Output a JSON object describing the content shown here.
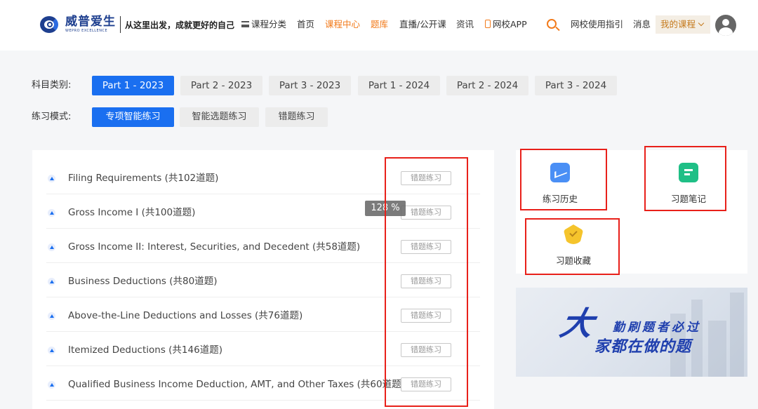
{
  "header": {
    "logo_cn": "威普爱生",
    "logo_en": "WEPRO EXCELLENCE",
    "slogan": "从这里出发，成就更好的自己",
    "nav": [
      {
        "label": "课程分类",
        "active": false
      },
      {
        "label": "首页",
        "active": false
      },
      {
        "label": "课程中心",
        "active": true
      },
      {
        "label": "题库",
        "active": true
      },
      {
        "label": "直播/公开课",
        "active": false
      },
      {
        "label": "资讯",
        "active": false
      },
      {
        "label": "网校APP",
        "active": false
      },
      {
        "label": "网校使用指引",
        "active": false
      },
      {
        "label": "消息",
        "active": false
      }
    ],
    "my_course": "我的课程"
  },
  "filters": {
    "subject_label": "科目类别:",
    "subjects": [
      "Part 1 - 2023",
      "Part 2 - 2023",
      "Part 3 - 2023",
      "Part 1 - 2024",
      "Part 2 - 2024",
      "Part 3 - 2024"
    ],
    "mode_label": "练习模式:",
    "modes": [
      "专项智能练习",
      "智能选题练习",
      "错题练习"
    ]
  },
  "chapters": [
    {
      "title": "Filing Requirements (共102道题)",
      "action": "错题练习"
    },
    {
      "title": "Gross Income I (共100道题)",
      "action": "错题练习"
    },
    {
      "title": "Gross Income II: Interest, Securities, and Decedent (共58道题)",
      "action": "错题练习"
    },
    {
      "title": "Business Deductions (共80道题)",
      "action": "错题练习"
    },
    {
      "title": "Above-the-Line Deductions and Losses (共76道题)",
      "action": "错题练习"
    },
    {
      "title": "Itemized Deductions (共146道题)",
      "action": "错题练习"
    },
    {
      "title": "Qualified Business Income Deduction, AMT, and Other Taxes (共60道题)",
      "action": "错题练习"
    }
  ],
  "zoom": "128 %",
  "tools": {
    "history": "练习历史",
    "notes": "习题笔记",
    "favorites": "习题收藏"
  },
  "banner": {
    "big_char": "大",
    "line1": "勤刷题者必过",
    "line2": "家都在做的题"
  },
  "colors": {
    "accent": "#1a6ff0",
    "nav_active": "#f27a1a",
    "highlight_box": "#e8201a"
  }
}
